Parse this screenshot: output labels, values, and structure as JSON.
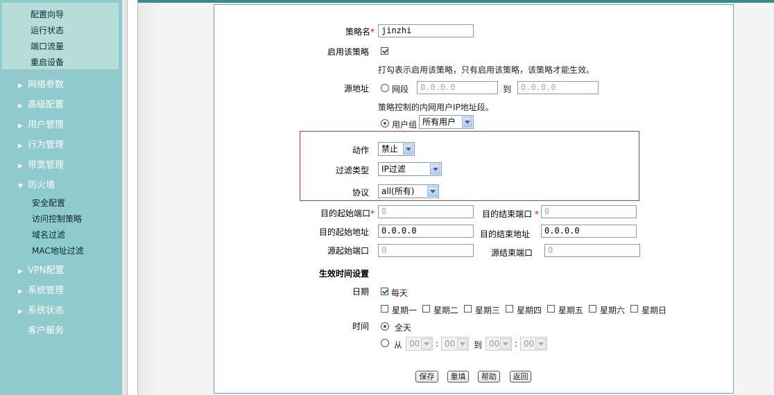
{
  "sidebar": {
    "top_items": [
      "配置向导",
      "运行状态",
      "端口流量",
      "重启设备"
    ],
    "menu": [
      {
        "label": "网络参数",
        "arrow": "right"
      },
      {
        "label": "高级配置",
        "arrow": "right"
      },
      {
        "label": "用户管理",
        "arrow": "right"
      },
      {
        "label": "行为管理",
        "arrow": "right"
      },
      {
        "label": "带宽管理",
        "arrow": "right"
      },
      {
        "label": "防火墙",
        "arrow": "down"
      },
      {
        "label": "VPN配置",
        "arrow": "right"
      },
      {
        "label": "系统管理",
        "arrow": "right"
      },
      {
        "label": "系统状态",
        "arrow": "right"
      },
      {
        "label": "客户服务",
        "arrow": "none"
      }
    ],
    "firewall_sub": [
      "安全配置",
      "访问控制策略",
      "域名过滤",
      "MAC地址过滤"
    ]
  },
  "form": {
    "policy_name_label": "策略名",
    "policy_name_value": "jinzhi",
    "enable_label": "启用该策略",
    "enable_checked": true,
    "enable_note": "打勾表示启用该策略，只有启用该策略，该策略才能生效。",
    "source_label": "源地址",
    "segment_label": "网段",
    "segment_from": "0.0.0.0",
    "to_label": "到",
    "segment_to": "0.0.0.0",
    "source_note": "策略控制的内网用户IP地址段。",
    "group_label": "用户组",
    "group_value": "所有用户",
    "action_label": "动作",
    "action_value": "禁止",
    "filter_label": "过滤类型",
    "filter_value": "IP过滤",
    "protocol_label": "协议",
    "protocol_value": "all(所有)",
    "dst_start_port_label": "目的起始端口",
    "dst_start_port_value": "0",
    "dst_end_port_label": "目的结束端口",
    "dst_end_port_value": "0",
    "dst_start_addr_label": "目的起始地址",
    "dst_start_addr_value": "0.0.0.0",
    "dst_end_addr_label": "目的结束地址",
    "dst_end_addr_value": "0.0.0.0",
    "src_start_port_label": "源起始端口",
    "src_start_port_value": "0",
    "src_end_port_label": "源结束端口",
    "src_end_port_value": "0",
    "time_section_title": "生效时间设置",
    "date_label": "日期",
    "everyday_label": "每天",
    "weekdays": [
      "星期一",
      "星期二",
      "星期三",
      "星期四",
      "星期五",
      "星期六",
      "星期日"
    ],
    "time_label": "时间",
    "all_day_label": "全天",
    "from_label": "从",
    "colon": ":",
    "to_time_label": "到",
    "time_values": [
      "00",
      "00",
      "00",
      "00"
    ]
  },
  "buttons": {
    "save": "保存",
    "reset": "重填",
    "help": "帮助",
    "back": "返回"
  },
  "colors": {
    "sidebar": "#8fcacd",
    "accent_box": "#e03030",
    "panel_border": "#6aa7a7"
  }
}
